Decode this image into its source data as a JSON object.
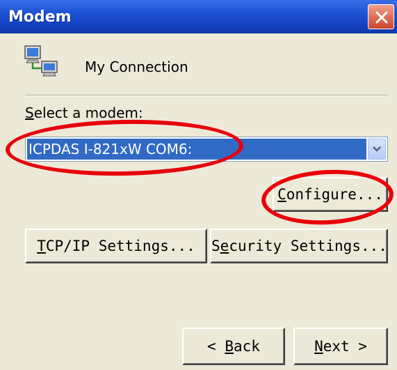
{
  "window": {
    "title": "Modem"
  },
  "connection": {
    "name": "My Connection"
  },
  "modem": {
    "label_prefix": "S",
    "label_rest": "elect a modem:",
    "selected_value": "ICPDAS I-821xW COM6:"
  },
  "buttons": {
    "configure_mnemonic": "C",
    "configure_rest": "onfigure...",
    "tcpip_mnemonic": "T",
    "tcpip_rest": "CP/IP Settings...",
    "security_prefix": "S",
    "security_mnemonic": "e",
    "security_rest": "curity Settings...",
    "back_prefix": "< ",
    "back_mnemonic": "B",
    "back_rest": "ack",
    "next_mnemonic": "N",
    "next_rest": "ext >"
  },
  "annotations": {
    "color": "#e8000b"
  },
  "icons": [
    "connection-icon",
    "close-icon",
    "dropdown-arrow-icon"
  ]
}
